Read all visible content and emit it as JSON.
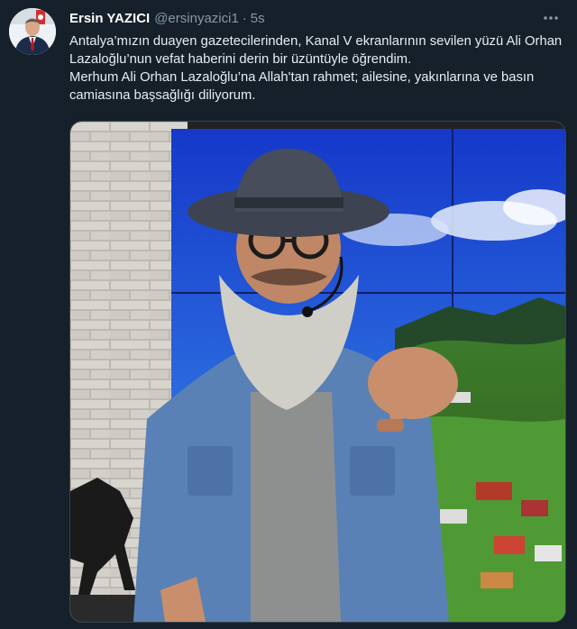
{
  "tweet": {
    "author": {
      "display_name": "Ersin YAZICI",
      "handle": "@ersinyazici1",
      "avatar_icon": "profile-photo"
    },
    "separator": "·",
    "time": "5s",
    "more_icon": "ellipsis-icon",
    "text": "Antalya’mızın duayen gazetecilerinden, Kanal V ekranlarının sevilen yüzü Ali Orhan Lazaloğlu’nun vefat haberini derin bir üzüntüyle öğrendim.\nMerhum Ali Orhan Lazaloğlu’na Allah'tan rahmet; ailesine, yakınlarına ve basın camiasına başsağlığı diliyorum.",
    "media": {
      "kind": "photo"
    }
  },
  "colors": {
    "background": "#15202b",
    "text": "#e7edf2",
    "secondary_text": "#8899a6",
    "border": "#38444d"
  }
}
